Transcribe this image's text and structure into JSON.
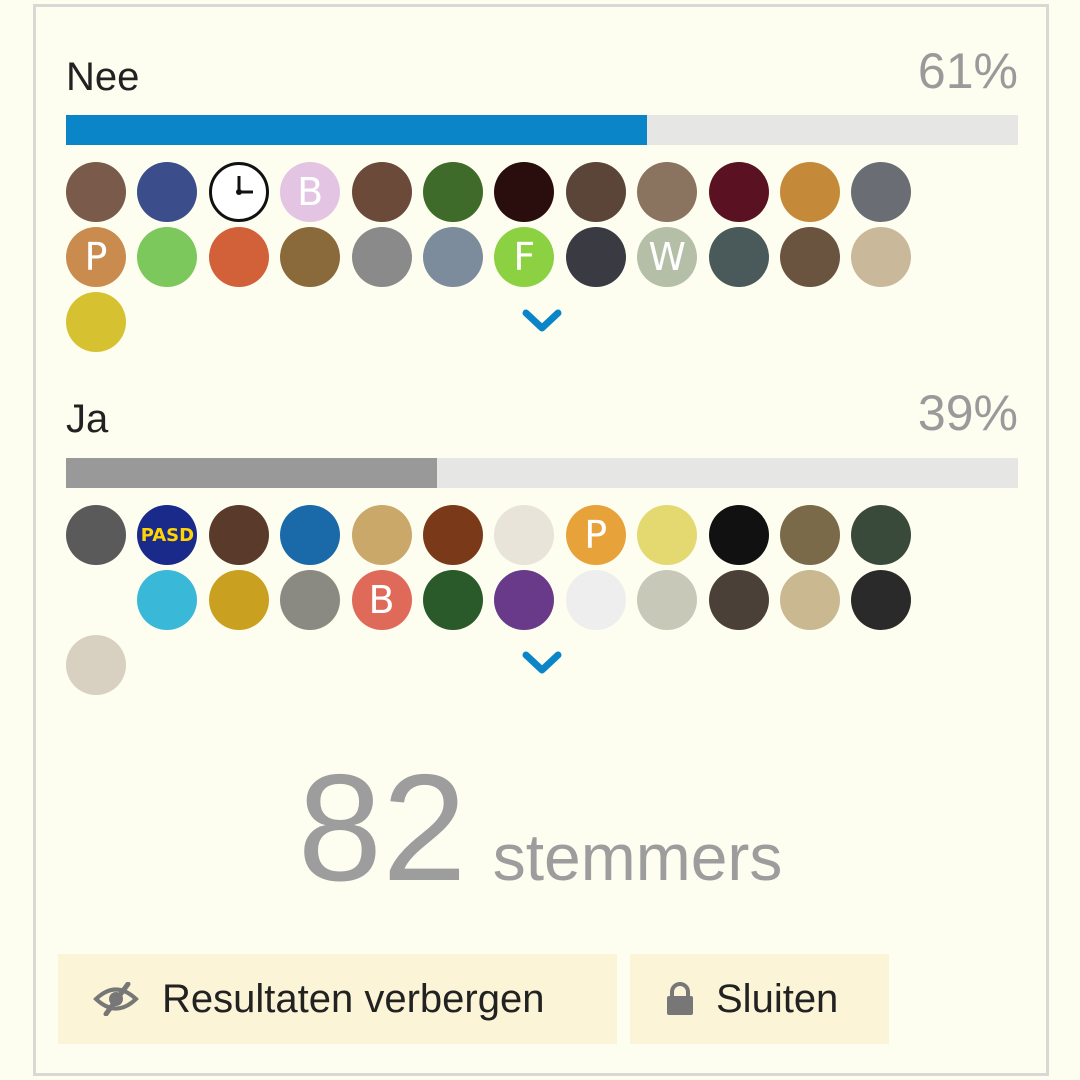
{
  "poll": {
    "options": [
      {
        "label": "Nee",
        "percent_text": "61%",
        "percent": 61,
        "color": "#0a86c8",
        "voters": [
          {
            "bg": "#7a5a4a",
            "letter": ""
          },
          {
            "bg": "#3b4d8a",
            "letter": ""
          },
          {
            "bg": "#ffffff",
            "letter": "",
            "icon": "clock"
          },
          {
            "bg": "#e3c4e3",
            "letter": "B"
          },
          {
            "bg": "#6b4a3a",
            "letter": ""
          },
          {
            "bg": "#3f6b2a",
            "letter": ""
          },
          {
            "bg": "#2a0d0d",
            "letter": ""
          },
          {
            "bg": "#5a4538",
            "letter": ""
          },
          {
            "bg": "#8a7460",
            "letter": ""
          },
          {
            "bg": "#5a1222",
            "letter": ""
          },
          {
            "bg": "#c48a3a",
            "letter": ""
          },
          {
            "bg": "#6a6e74",
            "letter": ""
          },
          {
            "bg": "#c98c4e",
            "letter": "P"
          },
          {
            "bg": "#7cc85c",
            "letter": ""
          },
          {
            "bg": "#d2613a",
            "letter": ""
          },
          {
            "bg": "#8a6a3a",
            "letter": ""
          },
          {
            "bg": "#8a8a8a",
            "letter": ""
          },
          {
            "bg": "#7c8c9c",
            "letter": ""
          },
          {
            "bg": "#8bd142",
            "letter": "F"
          },
          {
            "bg": "#3a3a42",
            "letter": ""
          },
          {
            "bg": "#b5bea6",
            "letter": "W"
          },
          {
            "bg": "#4a5a5a",
            "letter": ""
          },
          {
            "bg": "#6a5440",
            "letter": ""
          },
          {
            "bg": "#c9b89a",
            "letter": ""
          },
          {
            "bg": "#d6c230",
            "letter": ""
          }
        ]
      },
      {
        "label": "Ja",
        "percent_text": "39%",
        "percent": 39,
        "color": "#999999",
        "voters": [
          {
            "bg": "#5a5a5a",
            "letter": ""
          },
          {
            "bg": "#1a2a8a",
            "letter": "PASD"
          },
          {
            "bg": "#5a3a2a",
            "letter": ""
          },
          {
            "bg": "#1a6aaa",
            "letter": ""
          },
          {
            "bg": "#c9a86a",
            "letter": ""
          },
          {
            "bg": "#7a3a1a",
            "letter": ""
          },
          {
            "bg": "#e8e4da",
            "letter": ""
          },
          {
            "bg": "#e8a23a",
            "letter": "P"
          },
          {
            "bg": "#e4d870",
            "letter": ""
          },
          {
            "bg": "#111111",
            "letter": ""
          },
          {
            "bg": "#7a6a4a",
            "letter": ""
          },
          {
            "bg": "#3a4a3a",
            "letter": ""
          },
          {
            "bg": "#fdfdf0",
            "letter": ""
          },
          {
            "bg": "#3ab8d8",
            "letter": ""
          },
          {
            "bg": "#c9a020",
            "letter": ""
          },
          {
            "bg": "#8a8a82",
            "letter": ""
          },
          {
            "bg": "#e06a5a",
            "letter": "B"
          },
          {
            "bg": "#2a5a2a",
            "letter": ""
          },
          {
            "bg": "#6a3a8a",
            "letter": ""
          },
          {
            "bg": "#eeeeee",
            "letter": ""
          },
          {
            "bg": "#c8c8b8",
            "letter": ""
          },
          {
            "bg": "#4a4038",
            "letter": ""
          },
          {
            "bg": "#c9b890",
            "letter": ""
          },
          {
            "bg": "#2a2a2a",
            "letter": ""
          },
          {
            "bg": "#d8d0c0",
            "letter": ""
          }
        ]
      }
    ],
    "total_count": "82",
    "total_label": "stemmers",
    "buttons": {
      "hide_results": "Resultaten verbergen",
      "close": "Sluiten"
    },
    "accent_color": "#0a86c8"
  }
}
